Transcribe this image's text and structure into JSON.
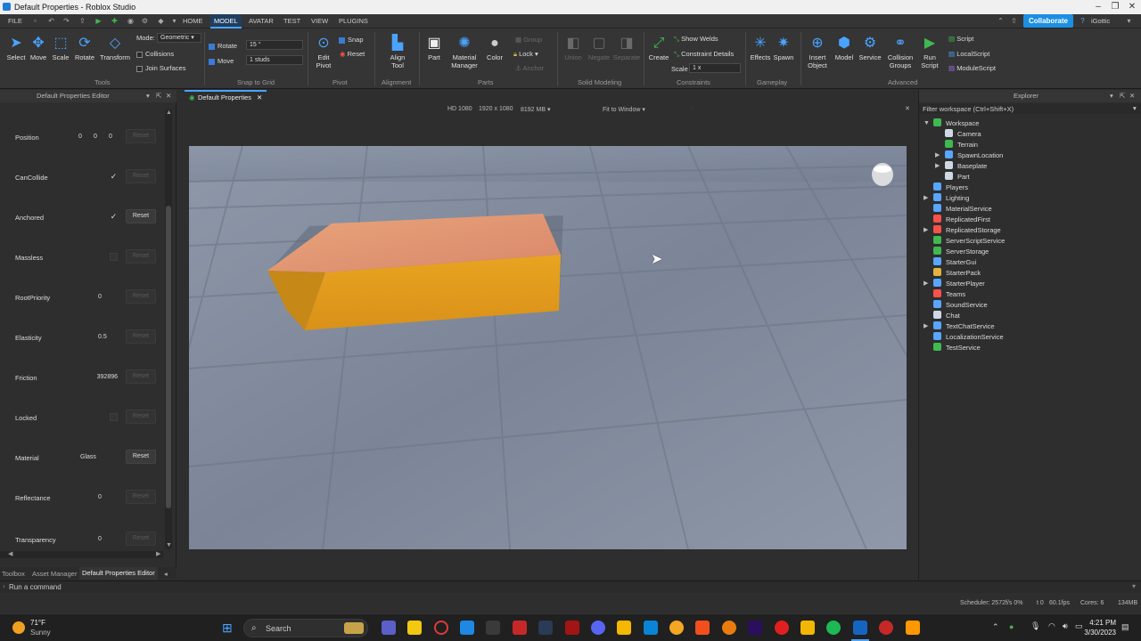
{
  "window": {
    "title": "Default Properties - Roblox Studio"
  },
  "menubar": {
    "file": "FILE",
    "tabs": [
      "HOME",
      "MODEL",
      "AVATAR",
      "TEST",
      "VIEW",
      "PLUGINS"
    ],
    "active_tab": "MODEL",
    "collaborate": "Collaborate",
    "user": "iGottic"
  },
  "ribbon": {
    "tools": {
      "select": "Select",
      "move": "Move",
      "scale": "Scale",
      "rotate": "Rotate",
      "transform": "Transform",
      "group": "Tools"
    },
    "mode": {
      "label": "Mode:",
      "value": "Geometric",
      "collisions": "Collisions",
      "join_surfaces": "Join Surfaces"
    },
    "snap": {
      "rotate_label": "Rotate",
      "rotate_value": "15 °",
      "move_label": "Move",
      "move_value": "1 studs",
      "group": "Snap to Grid"
    },
    "pivot": {
      "edit": "Edit",
      "pivot": "Pivot",
      "snap": "Snap",
      "reset": "Reset",
      "group": "Pivot"
    },
    "alignment": {
      "align": "Align",
      "tool": "Tool",
      "group": "Alignment"
    },
    "parts": {
      "part": "Part",
      "material": "Material",
      "manager": "Manager",
      "color": "Color",
      "group_btn": "Group",
      "lock": "Lock",
      "anchor": "Anchor",
      "group": "Parts"
    },
    "solid": {
      "union": "Union",
      "negate": "Negate",
      "separate": "Separate",
      "group": "Solid Modeling"
    },
    "constraints": {
      "create": "Create",
      "show_welds": "Show Welds",
      "constraint_details": "Constraint Details",
      "scale_label": "Scale",
      "scale_value": "1 x",
      "group": "Constraints"
    },
    "gameplay": {
      "effects": "Effects",
      "spawn": "Spawn",
      "group": "Gameplay"
    },
    "advanced": {
      "insert": "Insert",
      "object": "Object",
      "model": "Model",
      "service": "Service",
      "collision": "Collision",
      "groups": "Groups",
      "run": "Run",
      "script_btn": "Script",
      "script": "Script",
      "localscript": "LocalScript",
      "modulescript": "ModuleScript",
      "group": "Advanced"
    }
  },
  "left_panel": {
    "title": "Default Properties Editor",
    "properties": [
      {
        "name": "Position",
        "x": "0",
        "y": "0",
        "z": "0",
        "reset": "Reset"
      },
      {
        "name": "CanCollide",
        "value": "✓",
        "reset": "Reset"
      },
      {
        "name": "Anchored",
        "value": "✓",
        "reset": "Reset"
      },
      {
        "name": "Massless",
        "value": "",
        "reset": "Reset"
      },
      {
        "name": "RootPriority",
        "value": "0",
        "reset": "Reset"
      },
      {
        "name": "Elasticity",
        "value": "0.5",
        "reset": "Reset"
      },
      {
        "name": "Friction",
        "value": "392896",
        "reset": "Reset"
      },
      {
        "name": "Locked",
        "value": "",
        "reset": "Reset"
      },
      {
        "name": "Material",
        "value": "Glass",
        "reset": "Reset"
      },
      {
        "name": "Reflectance",
        "value": "0",
        "reset": "Reset"
      },
      {
        "name": "Transparency",
        "value": "0",
        "reset": "Reset"
      }
    ],
    "bottom_tabs": [
      "Toolbox",
      "Asset Manager",
      "Default Properties Editor"
    ]
  },
  "viewport": {
    "tab": "Default Properties",
    "resolution": "HD 1080",
    "size": "1920 x 1080",
    "memory": "8192 MB",
    "fit": "Fit to Window"
  },
  "explorer": {
    "title": "Explorer",
    "filter": "Filter workspace (Ctrl+Shift+X)",
    "items": [
      {
        "label": "Workspace",
        "color": "#3fb950"
      },
      {
        "label": "Camera",
        "color": "#cfd8e3"
      },
      {
        "label": "Terrain",
        "color": "#3fb950"
      },
      {
        "label": "SpawnLocation",
        "color": "#58a6ff"
      },
      {
        "label": "Baseplate",
        "color": "#cfd8e3"
      },
      {
        "label": "Part",
        "color": "#cfd8e3"
      },
      {
        "label": "Players",
        "color": "#58a6ff"
      },
      {
        "label": "Lighting",
        "color": "#58a6ff"
      },
      {
        "label": "MaterialService",
        "color": "#58a6ff"
      },
      {
        "label": "ReplicatedFirst",
        "color": "#f85149"
      },
      {
        "label": "ReplicatedStorage",
        "color": "#f85149"
      },
      {
        "label": "ServerScriptService",
        "color": "#3fb950"
      },
      {
        "label": "ServerStorage",
        "color": "#3fb950"
      },
      {
        "label": "StarterGui",
        "color": "#58a6ff"
      },
      {
        "label": "StarterPack",
        "color": "#e3b341"
      },
      {
        "label": "StarterPlayer",
        "color": "#58a6ff"
      },
      {
        "label": "Teams",
        "color": "#f85149"
      },
      {
        "label": "SoundService",
        "color": "#58a6ff"
      },
      {
        "label": "Chat",
        "color": "#cfd8e3"
      },
      {
        "label": "TextChatService",
        "color": "#58a6ff"
      },
      {
        "label": "LocalizationService",
        "color": "#58a6ff"
      },
      {
        "label": "TestService",
        "color": "#3fb950"
      }
    ]
  },
  "command_bar": {
    "placeholder": "Run a command"
  },
  "status": {
    "scheduler": "Scheduler: 2572f/s 0%",
    "t": "t 0",
    "fps": "60.1fps",
    "cores": "Cores: 6",
    "mem": "134MB"
  },
  "taskbar": {
    "weather_temp": "71°F",
    "weather_desc": "Sunny",
    "search": "Search",
    "time": "4:21 PM",
    "date": "3/30/2023"
  }
}
